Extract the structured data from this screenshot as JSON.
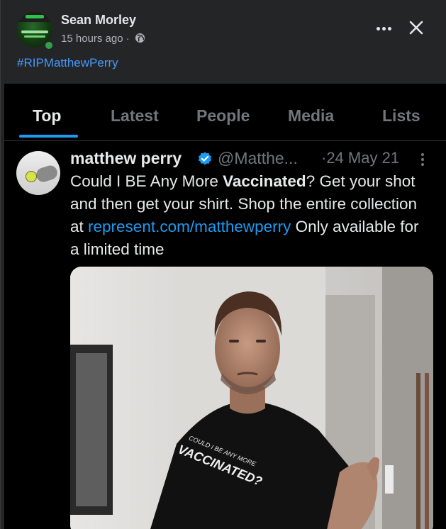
{
  "facebook_post": {
    "author": "Sean Morley",
    "time": "15 hours ago",
    "separator": "·",
    "hashtag": "#RIPMatthewPerry",
    "icons": {
      "privacy": "globe-icon",
      "more": "more-dots-icon",
      "close": "close-icon"
    }
  },
  "twitter": {
    "tabs": [
      {
        "label": "Top",
        "active": true
      },
      {
        "label": "Latest",
        "active": false
      },
      {
        "label": "People",
        "active": false
      },
      {
        "label": "Media",
        "active": false
      },
      {
        "label": "Lists",
        "active": false
      }
    ],
    "tweet": {
      "display_name": "matthew perry",
      "handle": "@Matthe...",
      "date": "·24 May 21",
      "text_part1": "Could I BE Any More ",
      "text_bold": "Vaccinated",
      "text_part2": "? Get your shot and then get your shirt. Shop the entire collection at ",
      "link": "represent.com/matthewperry",
      "text_part3": " Only available for a limited time",
      "shirt_text_line1": "COULD I BE ANY MORE",
      "shirt_text_line2": "VACCINATED?"
    }
  },
  "colors": {
    "fb_bg": "#242526",
    "hashtag": "#4599ff",
    "twitter_bg": "#000000",
    "twitter_blue": "#1d9bf0",
    "twitter_muted": "#71767b"
  }
}
